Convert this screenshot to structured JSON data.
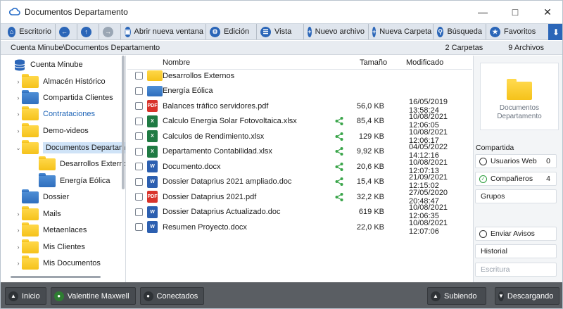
{
  "window": {
    "title": "Documentos Departamento"
  },
  "toolbar": {
    "escritorio": "Escritorio",
    "nueva_ventana": "Abrir nueva ventana",
    "edicion": "Edición",
    "vista": "Vista",
    "nuevo_archivo": "Nuevo archivo",
    "nueva_carpeta": "Nueva Carpeta",
    "busqueda": "Búsqueda",
    "favoritos": "Favoritos"
  },
  "path": {
    "text": "Cuenta Minube\\Documentos Departamento",
    "carpetas": "2 Carpetas",
    "archivos": "9 Archivos"
  },
  "tree": {
    "root": "Cuenta Minube",
    "items": [
      {
        "label": "Almacén Histórico",
        "color": "yellow"
      },
      {
        "label": "Compartida Clientes",
        "color": "blue"
      },
      {
        "label": "Contrataciones",
        "color": "yellow"
      },
      {
        "label": "Demo-videos",
        "color": "yellow"
      },
      {
        "label": "Documentos Departamento",
        "color": "yellow"
      },
      {
        "label": "Desarrollos Externos",
        "color": "yellow"
      },
      {
        "label": "Energía Eólica",
        "color": "blue"
      },
      {
        "label": "Dossier",
        "color": "blue"
      },
      {
        "label": "Mails",
        "color": "yellow"
      },
      {
        "label": "Metaenlaces",
        "color": "yellow"
      },
      {
        "label": "Mis Clientes",
        "color": "yellow"
      },
      {
        "label": "Mis Documentos",
        "color": "yellow"
      }
    ]
  },
  "files": {
    "headers": {
      "name": "Nombre",
      "size": "Tamaño",
      "modified": "Modificado"
    },
    "rows": [
      {
        "name": "Desarrollos Externos",
        "type": "folder-yellow",
        "size": "",
        "modified": "",
        "shared": false
      },
      {
        "name": "Energía Eólica",
        "type": "folder-blue",
        "size": "",
        "modified": "",
        "shared": false
      },
      {
        "name": "Balances tráfico servidores.pdf",
        "type": "pdf",
        "size": "56,0 KB",
        "modified": "16/05/2019 13:58:24",
        "shared": false
      },
      {
        "name": "Calculo Energia Solar Fotovoltaica.xlsx",
        "type": "xlsx",
        "size": "85,4 KB",
        "modified": "10/08/2021 12:06:05",
        "shared": true
      },
      {
        "name": "Calculos de Rendimiento.xlsx",
        "type": "xlsx",
        "size": "129 KB",
        "modified": "10/08/2021 12:06:17",
        "shared": true
      },
      {
        "name": "Departamento Contabilidad.xlsx",
        "type": "xlsx",
        "size": "9,92 KB",
        "modified": "04/05/2022 14:12:16",
        "shared": true
      },
      {
        "name": "Documento.docx",
        "type": "docx",
        "size": "20,6 KB",
        "modified": "10/08/2021 12:07:13",
        "shared": true
      },
      {
        "name": "Dossier Dataprius 2021 ampliado.doc",
        "type": "docx",
        "size": "15,4 KB",
        "modified": "21/09/2021 12:15:02",
        "shared": true
      },
      {
        "name": "Dossier Dataprius 2021.pdf",
        "type": "pdf",
        "size": "32,2 KB",
        "modified": "27/05/2020 20:48:47",
        "shared": true
      },
      {
        "name": "Dossier Dataprius Actualizado.doc",
        "type": "docx",
        "size": "619 KB",
        "modified": "10/08/2021 12:06:35",
        "shared": false
      },
      {
        "name": "Resumen Proyecto.docx",
        "type": "docx",
        "size": "22,0 KB",
        "modified": "10/08/2021 12:07:06",
        "shared": false
      }
    ]
  },
  "preview": {
    "line1": "Documentos",
    "line2": "Departamento"
  },
  "right": {
    "compartida": "Compartida",
    "usuarios_web": "Usuarios Web",
    "usuarios_web_count": "0",
    "companeros": "Compañeros",
    "companeros_count": "4",
    "grupos": "Grupos",
    "enviar_avisos": "Enviar Avisos",
    "historial": "Historial",
    "escritura": "Escritura"
  },
  "status": {
    "inicio": "Inicio",
    "user": "Valentine Maxwell",
    "conectados": "Conectados",
    "subiendo": "Subiendo",
    "descargando": "Descargando"
  },
  "colors": {
    "accent": "#2b66b8",
    "folder_yellow": "#f5c21a",
    "folder_blue": "#2f6ebd",
    "share_green": "#3aa54a",
    "statusbar": "#5a5e63"
  }
}
